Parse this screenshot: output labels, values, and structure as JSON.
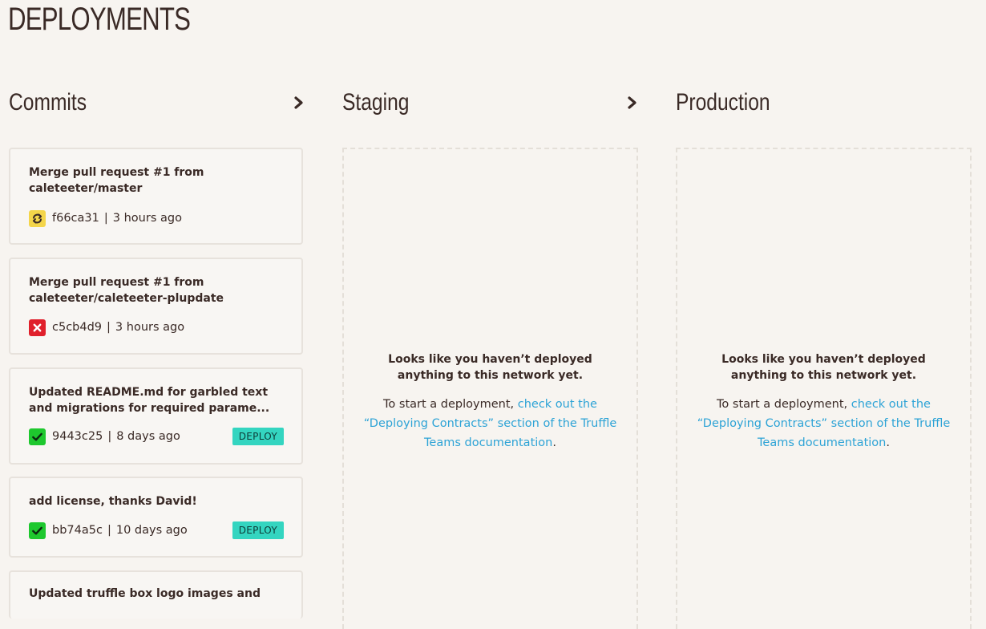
{
  "page": {
    "title": "DEPLOYMENTS"
  },
  "columns": {
    "commits": {
      "title": "Commits"
    },
    "staging": {
      "title": "Staging"
    },
    "production": {
      "title": "Production"
    }
  },
  "commits": [
    {
      "message": "Merge pull request #1 from caleteeter/master",
      "hash": "f66ca31",
      "age": "3 hours ago",
      "status": "pending",
      "status_icon": "refresh-icon"
    },
    {
      "message": "Merge pull request #1 from caleteeter/caleteeter-plupdate",
      "hash": "c5cb4d9",
      "age": "3 hours ago",
      "status": "failed",
      "status_icon": "x-icon"
    },
    {
      "message": "Updated README.md for garbled text and migrations for required parame...",
      "hash": "9443c25",
      "age": "8 days ago",
      "status": "passed",
      "status_icon": "check-icon",
      "deploy_label": "DEPLOY"
    },
    {
      "message": "add license, thanks David!",
      "hash": "bb74a5c",
      "age": "10 days ago",
      "status": "passed",
      "status_icon": "check-icon",
      "deploy_label": "DEPLOY"
    },
    {
      "message": "Updated truffle box logo images and"
    }
  ],
  "meta_separator": "|",
  "empty_state": {
    "heading": "Looks like you haven’t deployed anything to this network yet.",
    "body_prefix": "To start a deployment, ",
    "link_text": "check out the “Deploying Contracts” section of the Truffle Teams documentation",
    "body_suffix": "."
  },
  "colors": {
    "background": "#f7f4f0",
    "text": "#3a2a26",
    "link": "#2da3d6",
    "deploy_button": "#34d5c0",
    "status_pending": "#f4d54a",
    "status_failed": "#e0202b",
    "status_passed": "#1ec82e"
  }
}
